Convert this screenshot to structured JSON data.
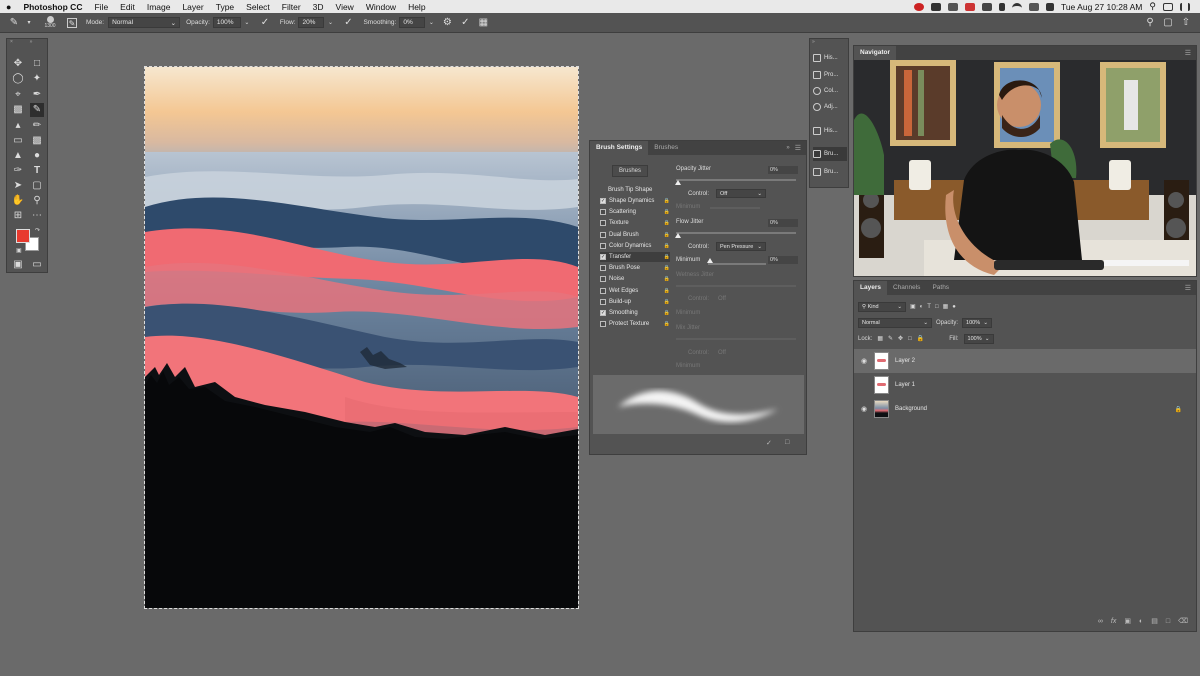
{
  "menubar": {
    "apple": "",
    "app_name": "Photoshop CC",
    "items": [
      "File",
      "Edit",
      "Image",
      "Layer",
      "Type",
      "Select",
      "Filter",
      "3D",
      "View",
      "Window",
      "Help"
    ],
    "clock": "Tue Aug 27  10:28 AM"
  },
  "options": {
    "brush_size": "1300",
    "mode_label": "Mode:",
    "mode_value": "Normal",
    "opacity_label": "Opacity:",
    "opacity_value": "100%",
    "flow_label": "Flow:",
    "flow_value": "20%",
    "smoothing_label": "Smoothing:",
    "smoothing_value": "0%"
  },
  "colors": {
    "foreground": "#e83a2e",
    "background": "#ffffff"
  },
  "dock": {
    "items": [
      "His...",
      "Pro...",
      "Col...",
      "Adj...",
      "His...",
      "Bru...",
      "Bru..."
    ]
  },
  "brush_settings": {
    "tabs": [
      "Brush Settings",
      "Brushes"
    ],
    "brushes_button": "Brushes",
    "tip_shape": "Brush Tip Shape",
    "items": [
      {
        "label": "Shape Dynamics",
        "checked": true
      },
      {
        "label": "Scattering",
        "checked": false
      },
      {
        "label": "Texture",
        "checked": false
      },
      {
        "label": "Dual Brush",
        "checked": false
      },
      {
        "label": "Color Dynamics",
        "checked": false
      },
      {
        "label": "Transfer",
        "checked": true
      },
      {
        "label": "Brush Pose",
        "checked": false
      },
      {
        "label": "Noise",
        "checked": false
      },
      {
        "label": "Wet Edges",
        "checked": false
      },
      {
        "label": "Build-up",
        "checked": false
      },
      {
        "label": "Smoothing",
        "checked": true
      },
      {
        "label": "Protect Texture",
        "checked": false
      }
    ],
    "opacity_jitter_label": "Opacity Jitter",
    "opacity_jitter_value": "0%",
    "control1_label": "Control:",
    "control1_value": "Off",
    "minimum1_label": "Minimum",
    "flow_jitter_label": "Flow Jitter",
    "flow_jitter_value": "0%",
    "control2_label": "Control:",
    "control2_value": "Pen Pressure",
    "minimum2_label": "Minimum",
    "minimum2_value": "0%",
    "wetness_label": "Wetness Jitter",
    "control3_label": "Control:",
    "control3_value": "Off",
    "minimum3_label": "Minimum",
    "mix_label": "Mix Jitter",
    "control4_label": "Control:",
    "control4_value": "Off",
    "minimum4_label": "Minimum"
  },
  "navigator": {
    "title": "Navigator"
  },
  "layers_panel": {
    "tabs": [
      "Layers",
      "Channels",
      "Paths"
    ],
    "kind_label": "Kind",
    "blend_mode": "Normal",
    "opacity_label": "Opacity:",
    "opacity_value": "100%",
    "lock_label": "Lock:",
    "fill_label": "Fill:",
    "fill_value": "100%",
    "layers": [
      {
        "name": "Layer 2",
        "visible": true,
        "selected": true
      },
      {
        "name": "Layer 1",
        "visible": false,
        "selected": false
      },
      {
        "name": "Background",
        "visible": true,
        "selected": false,
        "locked": true
      }
    ]
  }
}
